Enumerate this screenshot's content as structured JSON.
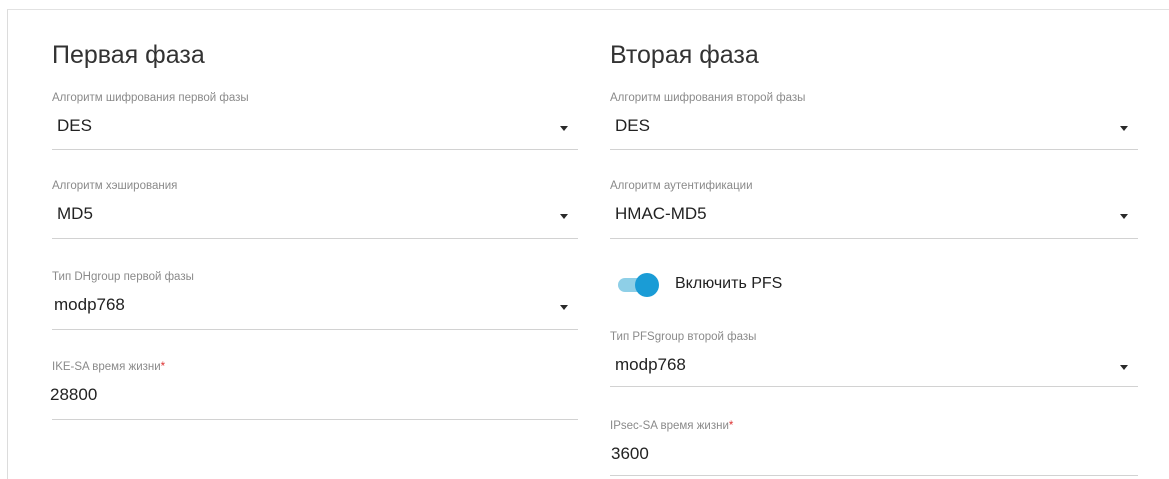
{
  "phase1": {
    "title": "Первая фаза",
    "encryption": {
      "label": "Алгоритм шифрования первой фазы",
      "value": "DES"
    },
    "hash": {
      "label": "Алгоритм хэширования",
      "value": "MD5"
    },
    "dh_group": {
      "label": "Тип DHgroup первой фазы",
      "value": "modp768"
    },
    "ike_lifetime": {
      "label": "IKE-SA время жизни",
      "required_mark": "*",
      "value": "28800"
    }
  },
  "phase2": {
    "title": "Вторая фаза",
    "encryption": {
      "label": "Алгоритм шифрования второй фазы",
      "value": "DES"
    },
    "auth": {
      "label": "Алгоритм аутентификации",
      "value": "HMAC-MD5"
    },
    "pfs_toggle": {
      "label": "Включить PFS",
      "on": true
    },
    "pfs_group": {
      "label": "Тип PFSgroup второй фазы",
      "value": "modp768"
    },
    "ipsec_lifetime": {
      "label": "IPsec-SA время жизни",
      "required_mark": "*",
      "value": "3600"
    }
  },
  "colors": {
    "accent": "#1a9cd6",
    "accent_light": "#8ecfe7",
    "required": "#dd3333"
  }
}
